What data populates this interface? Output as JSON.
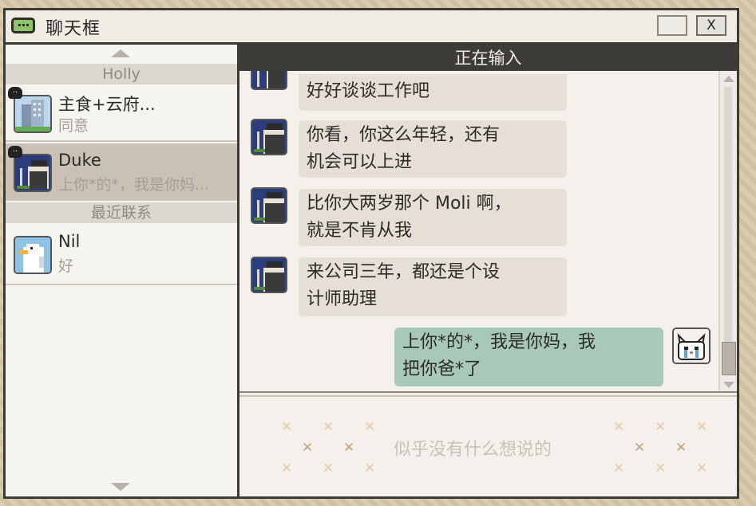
{
  "window": {
    "title": "聊天框",
    "close_label": "X"
  },
  "sidebar": {
    "groups": [
      {
        "header": "Holly"
      },
      {
        "header": "最近联系"
      }
    ],
    "contacts": [
      {
        "name": "主食+云府...",
        "preview": "同意"
      },
      {
        "name": "Duke",
        "preview": "上你*的*，我是你妈..."
      },
      {
        "name": "Nil",
        "preview": "好"
      }
    ]
  },
  "chat": {
    "status": "正在输入",
    "messages": [
      {
        "from": "Duke",
        "lines": [
          "好好谈谈工作吧"
        ]
      },
      {
        "from": "Duke",
        "lines": [
          "你看，你这么年轻，还有",
          "机会可以上进"
        ]
      },
      {
        "from": "Duke",
        "lines": [
          "比你大两岁那个 Moli 啊，",
          "就是不肯从我"
        ]
      },
      {
        "from": "Duke",
        "lines": [
          "来公司三年，都还是个设",
          "计师助理"
        ]
      },
      {
        "from": "me",
        "lines": [
          "上你*的*，我是你妈，我",
          "把你爸*了"
        ]
      }
    ]
  },
  "input": {
    "placeholder": "似乎没有什么想说的"
  },
  "colors": {
    "window_border": "#3c3a36",
    "header_bg": "#3e3c39",
    "my_bubble": "#a8c8b8",
    "their_bubble": "#e5dfd6",
    "selected_row": "#c9c1b3"
  }
}
